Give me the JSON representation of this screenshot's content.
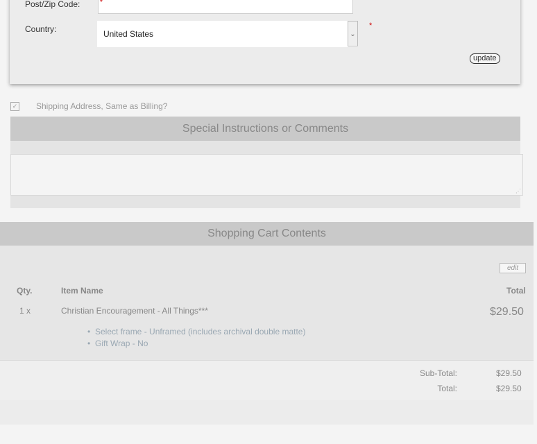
{
  "billing": {
    "zip_label": "Post/Zip Code:",
    "zip_value": "*",
    "country_label": "Country:",
    "country_value": "United States",
    "country_chevron": "⌄",
    "required_mark": "*",
    "update_label": "update"
  },
  "shipping": {
    "same_as_billing_label": "Shipping Address, Same as Billing?",
    "checked": true,
    "check_glyph": "✓"
  },
  "instructions": {
    "heading": "Special Instructions or Comments",
    "value": "",
    "grip_glyph": "⋰"
  },
  "cart": {
    "heading": "Shopping Cart Contents",
    "edit_label": "edit",
    "columns": {
      "qty": "Qty.",
      "item": "Item Name",
      "total": "Total"
    },
    "items": [
      {
        "qty": "1 x",
        "name": "Christian Encouragement - All Things***",
        "price": "$29.50",
        "options": [
          "Select frame - Unframed (includes archival double matte)",
          "Gift Wrap - No"
        ]
      }
    ],
    "subtotal_label": "Sub-Total:",
    "subtotal_value": "$29.50",
    "total_label": "Total:",
    "total_value": "$29.50"
  }
}
